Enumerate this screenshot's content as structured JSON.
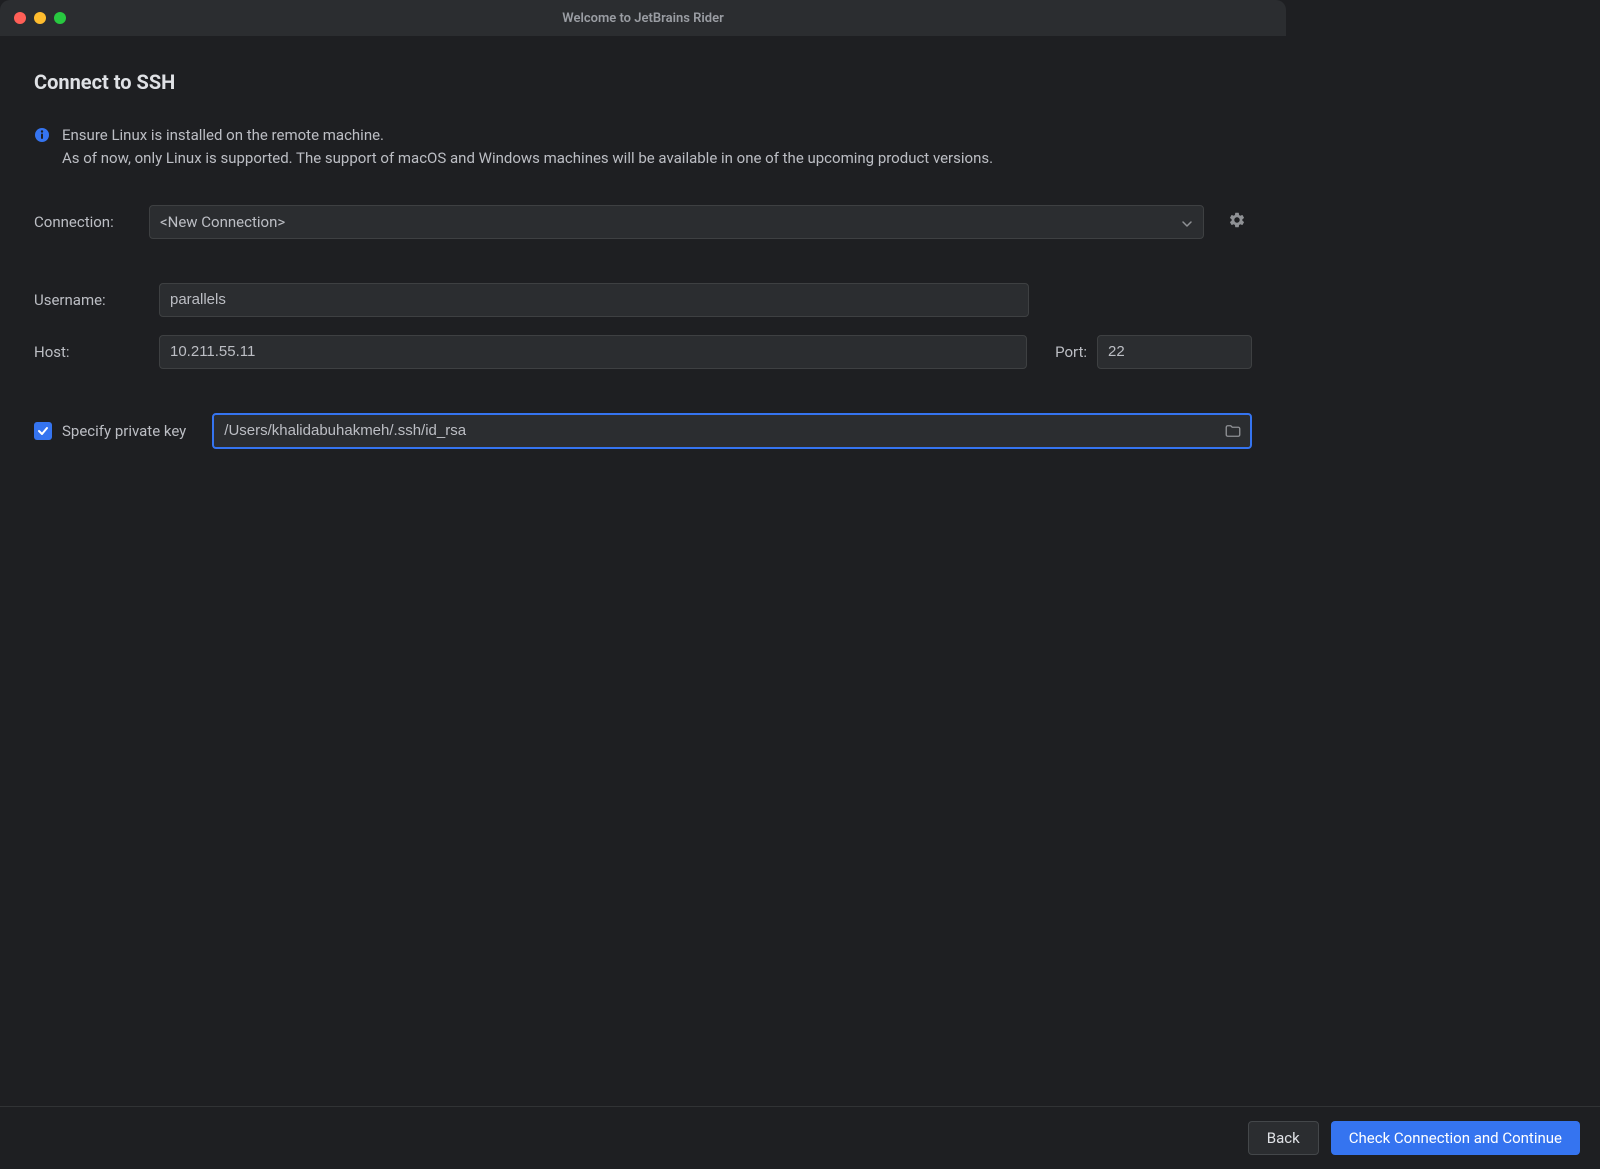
{
  "window": {
    "title": "Welcome to JetBrains Rider"
  },
  "page": {
    "title": "Connect to SSH"
  },
  "info": {
    "line1": "Ensure Linux is installed on the remote machine.",
    "line2": "As of now, only Linux is supported. The support of macOS and Windows machines will be available in one of the upcoming product versions."
  },
  "labels": {
    "connection": "Connection:",
    "username": "Username:",
    "host": "Host:",
    "port": "Port:",
    "specify_private_key": "Specify private key"
  },
  "fields": {
    "connection_selected": "<New Connection>",
    "username": "parallels",
    "host": "10.211.55.11",
    "port": "22",
    "private_key_path": "/Users/khalidabuhakmeh/.ssh/id_rsa",
    "specify_private_key_checked": true
  },
  "buttons": {
    "back": "Back",
    "check_continue": "Check Connection and Continue"
  },
  "colors": {
    "accent": "#3574f0",
    "background": "#1e1f22",
    "panel": "#2b2d30"
  }
}
